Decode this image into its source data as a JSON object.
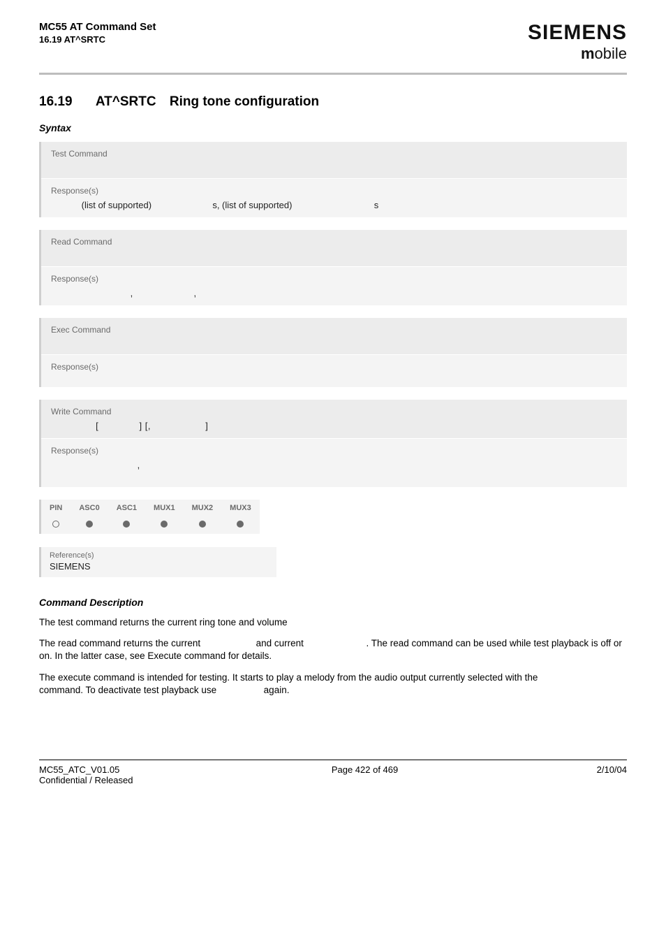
{
  "header": {
    "doc_title": "MC55 AT Command Set",
    "doc_sub": "16.19 AT^SRTC",
    "brand_name": "SIEMENS",
    "brand_sub_m": "m",
    "brand_sub_rest": "obile"
  },
  "section": {
    "number": "16.19",
    "cmd": "AT^SRTC",
    "title_rest": "Ring tone configuration",
    "syntax_label": "Syntax"
  },
  "boxes": {
    "test": {
      "label": "Test Command",
      "resp_label": "Response(s)",
      "resp_text_a": "(list of supported)",
      "resp_text_b": "s, (list of supported)",
      "resp_text_c": "s"
    },
    "read": {
      "label": "Read Command",
      "resp_label": "Response(s)",
      "comma1": ",",
      "comma2": ","
    },
    "exec": {
      "label": "Exec Command",
      "resp_label": "Response(s)"
    },
    "write": {
      "label": "Write Command",
      "bracket_open": "[",
      "bracket_mid": "] [,",
      "bracket_close": "]",
      "resp_label": "Response(s)",
      "comma": ","
    }
  },
  "pin_table": {
    "headers": [
      "PIN",
      "ASC0",
      "ASC1",
      "MUX1",
      "MUX2",
      "MUX3"
    ],
    "values": [
      "open",
      "filled",
      "filled",
      "filled",
      "filled",
      "filled"
    ]
  },
  "reference": {
    "label": "Reference(s)",
    "value": "SIEMENS"
  },
  "cmd_desc": {
    "heading": "Command Description",
    "p1": "The test command returns the current ring tone and volume",
    "p2a": "The read command returns the current",
    "p2b": "and current",
    "p2c": ". The read command can be used while test playback is off or on. In the latter case, see Execute command for details.",
    "p3a": "The execute command is intended for testing. It starts to play a melody from the audio output currently selected with the",
    "p3b": "command. To deactivate test playback use",
    "p3c": "again."
  },
  "footer": {
    "left1": "MC55_ATC_V01.05",
    "left2": "Confidential / Released",
    "mid": "Page 422 of 469",
    "right": "2/10/04"
  }
}
